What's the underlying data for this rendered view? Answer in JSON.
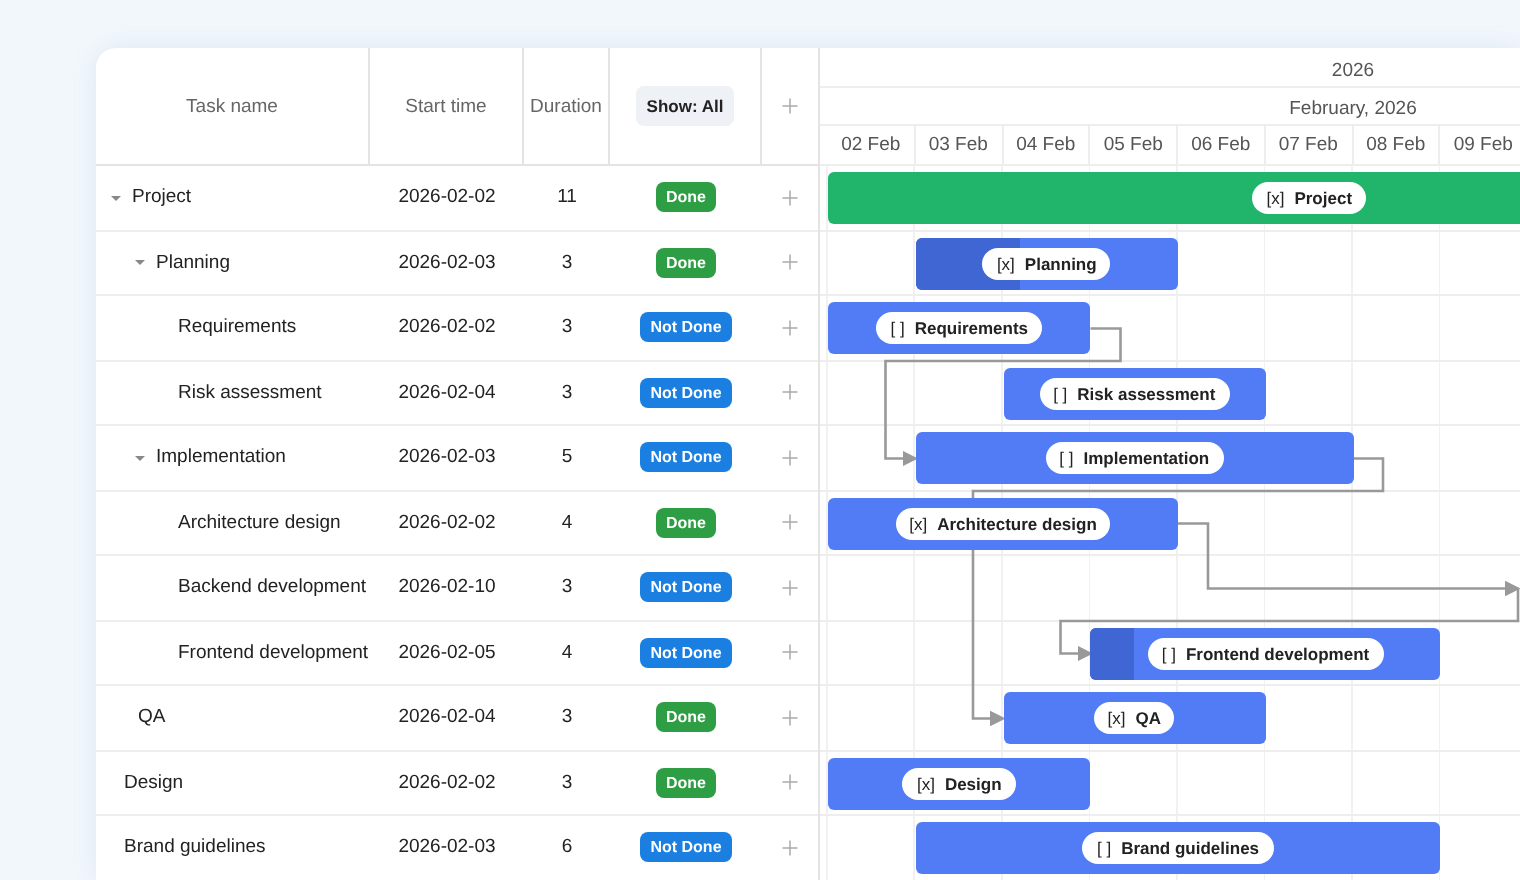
{
  "header": {
    "columns": [
      "Task name",
      "Start time",
      "Duration"
    ],
    "filter": "Show: All"
  },
  "timeline": {
    "year": "2026",
    "month": "February, 2026",
    "days": [
      "02 Feb",
      "03 Feb",
      "04 Feb",
      "05 Feb",
      "06 Feb",
      "07 Feb",
      "08 Feb",
      "09 Feb"
    ]
  },
  "tasks": [
    {
      "name": "Project",
      "start": "2026-02-02",
      "duration": "11",
      "status": "Done",
      "done": true,
      "kind": "project",
      "expanded": true,
      "bar_check": "[x]",
      "bar_label": "Project",
      "children": [
        {
          "name": "Planning",
          "start": "2026-02-03",
          "duration": "3",
          "status": "Done",
          "done": true,
          "kind": "task",
          "expanded": true,
          "level": 0.4,
          "bar_check": "[x]",
          "bar_label": "Planning",
          "children": [
            {
              "name": "Requirements",
              "start": "2026-02-02",
              "duration": "3",
              "status": "Not Done",
              "done": false,
              "kind": "task",
              "bar_check": "[ ]",
              "bar_label": "Requirements"
            },
            {
              "name": "Risk assessment",
              "start": "2026-02-04",
              "duration": "3",
              "status": "Not Done",
              "done": false,
              "kind": "task",
              "bar_check": "[ ]",
              "bar_label": "Risk assessment"
            }
          ]
        },
        {
          "name": "Implementation",
          "start": "2026-02-03",
          "duration": "5",
          "status": "Not Done",
          "done": false,
          "kind": "task",
          "expanded": true,
          "bar_check": "[ ]",
          "bar_label": "Implementation",
          "children": [
            {
              "name": "Architecture design",
              "start": "2026-02-02",
              "duration": "4",
              "status": "Done",
              "done": true,
              "kind": "task",
              "bar_check": "[x]",
              "bar_label": "Architecture design"
            },
            {
              "name": "Backend development",
              "start": "2026-02-10",
              "duration": "3",
              "status": "Not Done",
              "done": false
            },
            {
              "name": "Frontend development",
              "start": "2026-02-05",
              "duration": "4",
              "status": "Not Done",
              "done": false,
              "kind": "task",
              "level": 0.125,
              "bar_check": "[ ]",
              "bar_label": "Frontend development"
            }
          ]
        },
        {
          "name": "QA",
          "start": "2026-02-04",
          "duration": "3",
          "status": "Done",
          "done": true,
          "kind": "task",
          "bar_check": "[x]",
          "bar_label": "QA"
        }
      ]
    },
    {
      "name": "Design",
      "start": "2026-02-02",
      "duration": "3",
      "status": "Done",
      "done": true,
      "kind": "task",
      "bar_check": "[x]",
      "bar_label": "Design"
    },
    {
      "name": "Brand guidelines",
      "start": "2026-02-03",
      "duration": "6",
      "status": "Not Done",
      "done": false,
      "kind": "task",
      "bar_check": "[ ]",
      "bar_label": "Brand guidelines"
    }
  ]
}
